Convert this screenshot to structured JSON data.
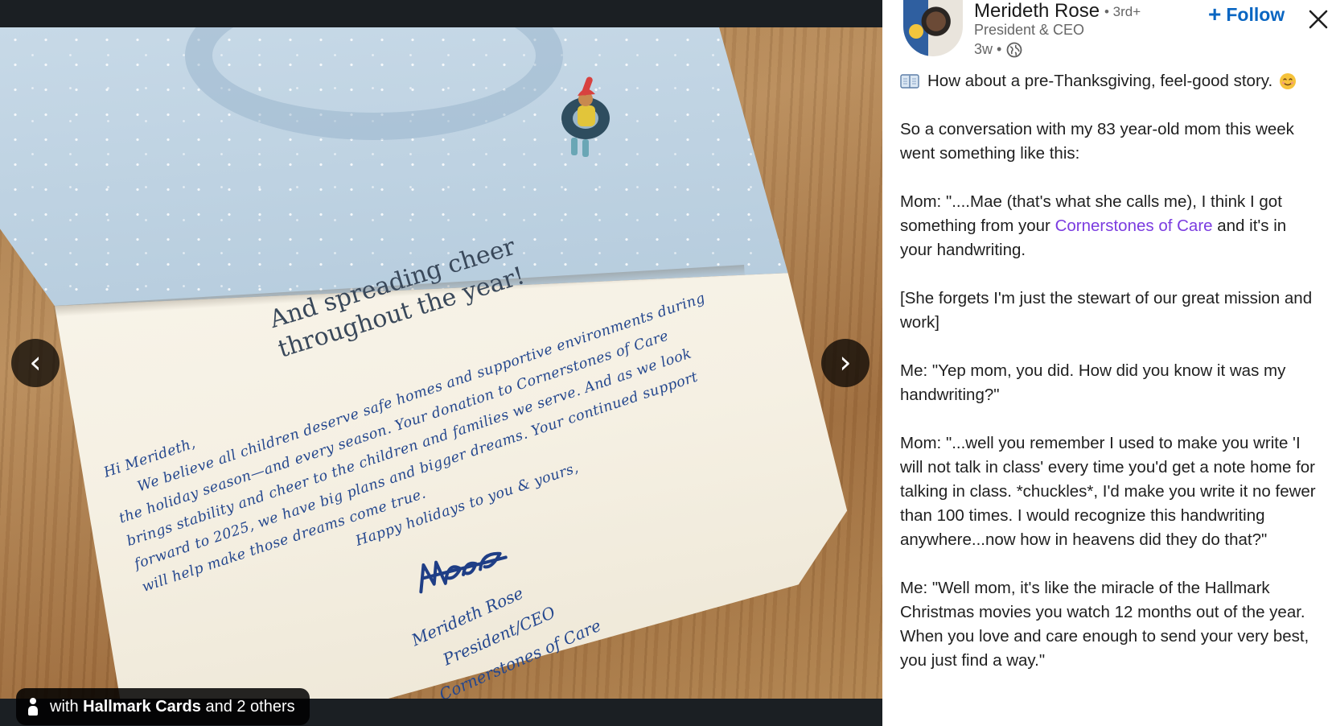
{
  "viewer": {
    "card": {
      "printed_line_1": "And spreading cheer",
      "printed_line_2": "throughout the year!",
      "note_lines": [
        "Hi Merideth,",
        "We believe all children deserve safe homes and supportive environments during",
        "the holiday season—and every season. Your donation to Cornerstones of Care",
        "brings stability and cheer to the children and families we serve. And as we look",
        "forward to 2025, we have big plans and bigger dreams. Your continued support",
        "will help make those dreams come true.",
        "Happy holidays to you & yours,"
      ],
      "signature_name": "Merideth Rose",
      "signature_title": "President/CEO",
      "signature_org": "Cornerstones of Care"
    },
    "prev_label": "‹",
    "next_label": "›",
    "tag_pill": {
      "prefix": "with",
      "company": "Hallmark Cards",
      "suffix": "and 2 others"
    }
  },
  "post": {
    "author": {
      "name": "Merideth Rose",
      "degree": "• 3rd+",
      "title": "President & CEO",
      "time": "3w •"
    },
    "follow_label": "Follow",
    "body": {
      "intro": "How about a pre-Thanksgiving, feel-good story.",
      "p1": "So a conversation with my 83 year-old mom this week went something like this:",
      "p2_before": "Mom: \"....Mae (that's what she calls me), I think I got something from your ",
      "p2_mention": "Cornerstones of Care",
      "p2_after": " and it's in your handwriting.",
      "p3": "[She forgets I'm just the stewart of our great mission and work]",
      "p4": "Me: \"Yep mom, you did. How did you know it was my handwriting?\"",
      "p5": "Mom: \"...well you remember I used to make you write 'I will not talk in class' every time you'd get a note home for talking in class. *chuckles*, I'd make you write it no fewer than 100 times. I would recognize this handwriting anywhere...now how in heavens did they do that?\"",
      "p6": "Me: \"Well mom, it's like the miracle of the Hallmark Christmas movies you watch 12 months out of the year. When you love and care enough to send your very best, you just find a way.\""
    }
  },
  "colors": {
    "link_blue": "#0a66c2",
    "mention_purple": "#7b3ce0",
    "ink_blue": "#24478e"
  }
}
